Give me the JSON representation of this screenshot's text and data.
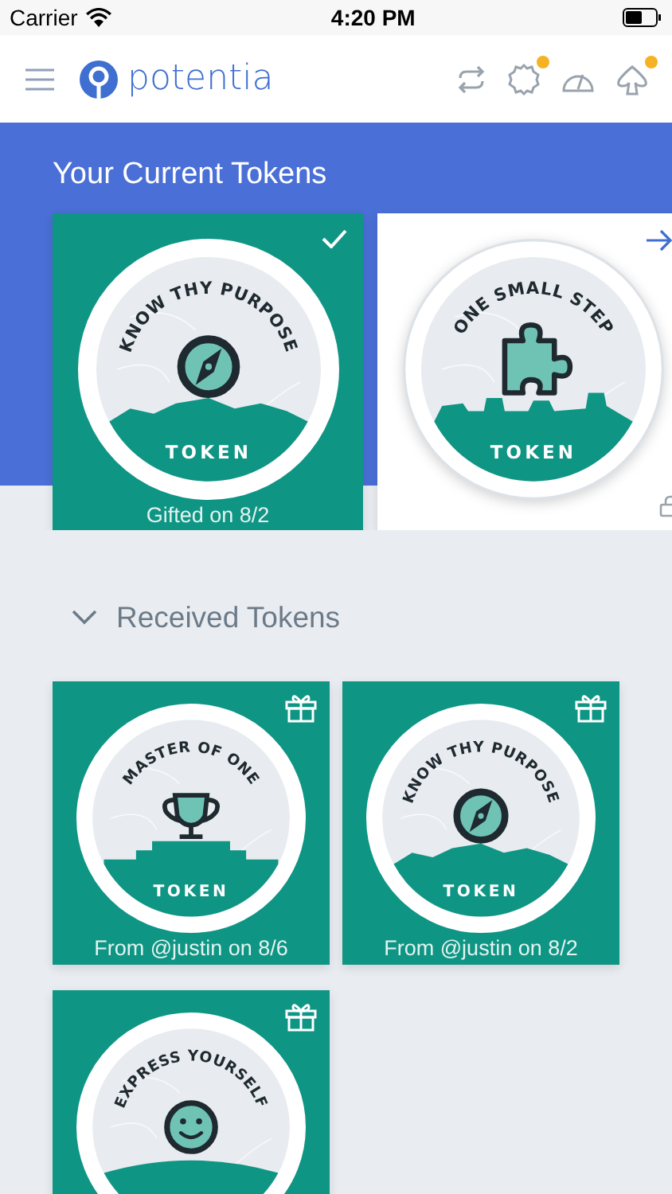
{
  "status_bar": {
    "carrier": "Carrier",
    "time": "4:20 PM"
  },
  "header": {
    "logo_text": "potentia",
    "actions": [
      {
        "kind": "sync",
        "badge": false
      },
      {
        "kind": "settings",
        "badge": true
      },
      {
        "kind": "gauge",
        "badge": false
      },
      {
        "kind": "cloud",
        "badge": true
      }
    ]
  },
  "current": {
    "title": "Your Current Tokens",
    "tokens": [
      {
        "title": "KNOW THY PURPOSE",
        "kind": "compass",
        "banner": "TOKEN",
        "footer": "Gifted on 8/2",
        "selected": true
      },
      {
        "title": "ONE SMALL STEP",
        "kind": "puzzle",
        "banner": "TOKEN",
        "selected": false
      }
    ]
  },
  "received": {
    "title": "Received Tokens",
    "expanded": true,
    "tokens": [
      {
        "title": "MASTER OF ONE",
        "kind": "trophy",
        "banner": "TOKEN",
        "footer": "From @justin on 8/6"
      },
      {
        "title": "KNOW THY PURPOSE",
        "kind": "compass",
        "banner": "TOKEN",
        "footer": "From @justin on 8/2"
      },
      {
        "title": "EXPRESS YOURSELF",
        "kind": "smiley"
      }
    ]
  }
}
